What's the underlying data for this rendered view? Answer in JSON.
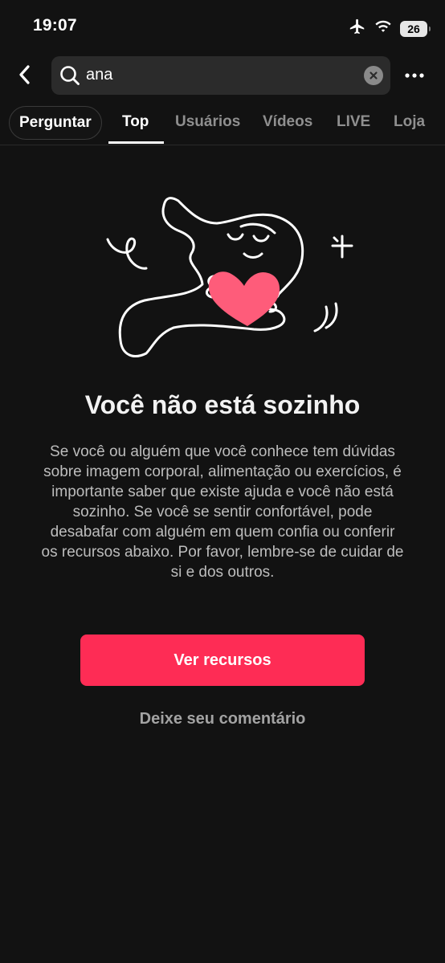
{
  "status_bar": {
    "time": "19:07",
    "battery_level": "26",
    "icons": [
      "airplane-icon",
      "wifi-icon",
      "battery-icon"
    ]
  },
  "header": {
    "search": {
      "value": "ana",
      "icon": "search-icon"
    },
    "back_icon": "chevron-left-icon",
    "clear_icon": "close-icon",
    "more_icon": "more-horizontal-icon"
  },
  "tabs": {
    "ask_label": "Perguntar",
    "items": [
      {
        "label": "Top",
        "active": true
      },
      {
        "label": "Usuários",
        "active": false
      },
      {
        "label": "Vídeos",
        "active": false
      },
      {
        "label": "LIVE",
        "active": false
      },
      {
        "label": "Loja",
        "active": false
      }
    ]
  },
  "content": {
    "illustration": "person-hugging-heart-illustration",
    "title": "Você não está sozinho",
    "body": "Se você ou alguém que você conhece tem dúvidas sobre imagem corporal, alimentação ou exercícios, é importante saber que existe ajuda e você não está sozinho. Se você se sentir confortável, pode desabafar com alguém em quem confia ou conferir os recursos abaixo. Por favor, lembre-se de cuidar de si e dos outros.",
    "primary_button": "Ver recursos",
    "secondary_link": "Deixe seu comentário"
  },
  "colors": {
    "background": "#121212",
    "accent": "#fe2c55",
    "heart": "#fe5c7a",
    "search_bg": "#2b2b2b"
  }
}
